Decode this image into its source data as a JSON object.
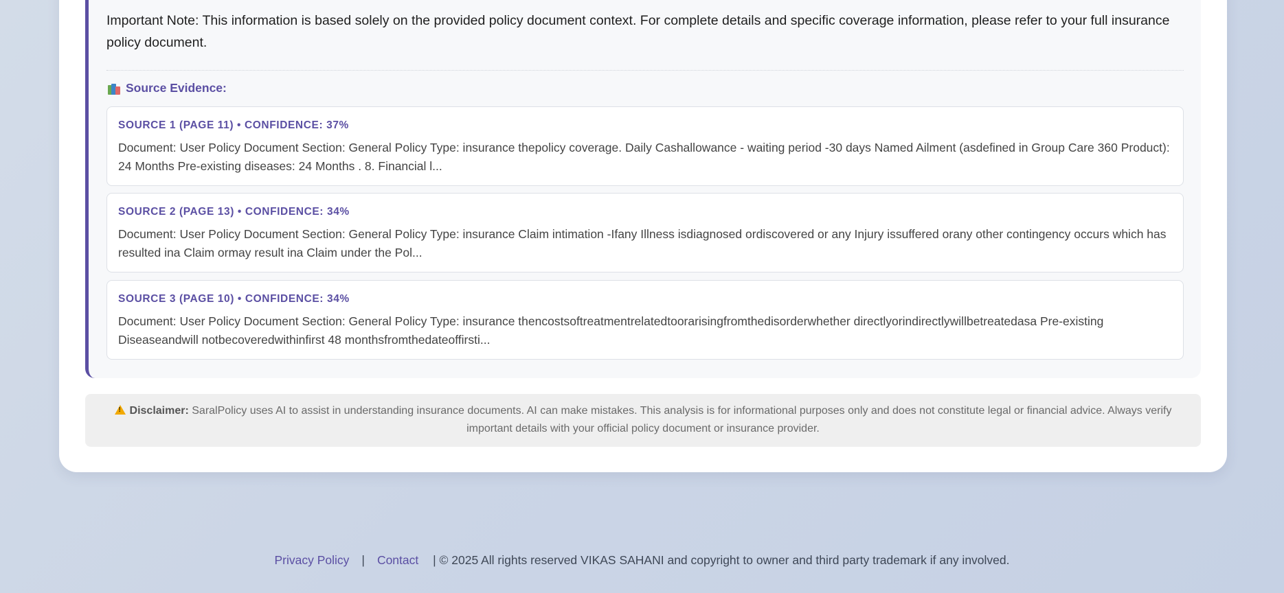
{
  "answer": {
    "note": "Important Note: This information is based solely on the provided policy document context. For complete details and specific coverage information, please refer to your full insurance policy document.",
    "source_heading": "Source Evidence:",
    "sources": [
      {
        "title": "SOURCE 1 (PAGE 11) • CONFIDENCE: 37%",
        "text": "Document: User Policy Document Section: General Policy Type: insurance thepolicy coverage. Daily Cashallowance - waiting period -30 days Named Ailment (asdefined in Group Care 360 Product): 24 Months Pre-existing diseases: 24 Months . 8. Financial l..."
      },
      {
        "title": "SOURCE 2 (PAGE 13) • CONFIDENCE: 34%",
        "text": "Document: User Policy Document Section: General Policy Type: insurance Claim intimation -Ifany Illness isdiagnosed ordiscovered or any Injury issuffered orany other contingency occurs which has resulted ina Claim ormay result ina Claim under the Pol..."
      },
      {
        "title": "SOURCE 3 (PAGE 10) • CONFIDENCE: 34%",
        "text": "Document: User Policy Document Section: General Policy Type: insurance thencostsoftreatmentrelatedtoorarisingfromthedisorderwhether directlyorindirectlywillbetreatedasa Pre-existing Diseaseandwill notbecoveredwithinfirst 48 monthsfromthedateoffirsti..."
      }
    ]
  },
  "disclaimer": {
    "label": "Disclaimer:",
    "text": "SaralPolicy uses AI to assist in understanding insurance documents. AI can make mistakes. This analysis is for informational purposes only and does not constitute legal or financial advice. Always verify important details with your official policy document or insurance provider."
  },
  "footer": {
    "privacy_link": "Privacy Policy",
    "separator": "|",
    "contact_link": "Contact",
    "copyright": "| © 2025 All rights reserved VIKAS SAHANI and copyright to owner and third party trademark if any involved."
  },
  "colors": {
    "accent": "#5b4fa3",
    "warning": "#f2a900"
  },
  "icons": {
    "source_heading": "books-icon",
    "disclaimer": "warning-icon"
  }
}
